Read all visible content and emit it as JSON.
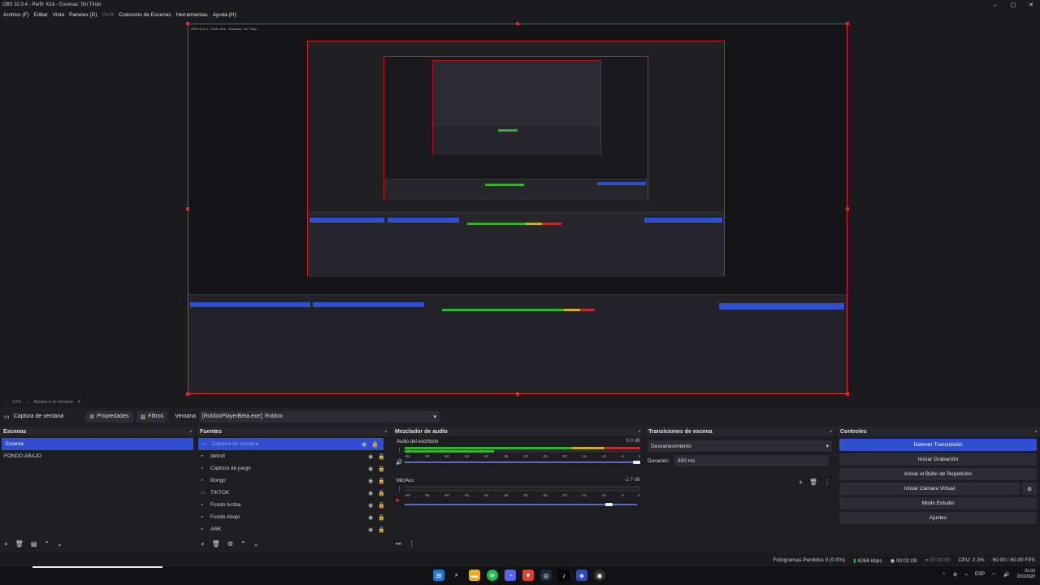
{
  "app": {
    "title": "OBS 32.0.4 - Perfil: Kick - Escenas: Sin Título",
    "window_controls": [
      "–",
      "▢",
      "✕"
    ]
  },
  "menu": {
    "items": [
      "Archivo (F)",
      "Editar",
      "Vista",
      "Paneles (D)",
      "Perfil",
      "Colección de Escenas",
      "Herramientas",
      "Ayuda (H)"
    ]
  },
  "zoom": {
    "level": "53%",
    "fit_label": "Ajustar a la ventana"
  },
  "source_bar": {
    "source_name": "Captura de ventana",
    "properties_label": "Propiedades",
    "filters_label": "Filtros",
    "window_label": "Ventana",
    "window_value": "[RobloxPlayerBeta.exe]: Roblox"
  },
  "scenes": {
    "title": "Escenas",
    "items": [
      "Escena",
      "FONDO ABAJO"
    ]
  },
  "sources": {
    "title": "Fuentes",
    "items": [
      "Captura de ventana",
      "detroit",
      "Captura de juego",
      "Bongo",
      "TIKTOK",
      "Fondo Arriba",
      "Fondo Abajo",
      "ARK"
    ]
  },
  "mixer": {
    "title": "Mezclador de audio",
    "channels": [
      {
        "name": "Audio del escritorio",
        "db": "0.0 dB",
        "level": 0.85,
        "volume": 1.0
      },
      {
        "name": "Mic/Aux",
        "db": "-2.7 dB",
        "level": 0.0,
        "volume": 0.86
      }
    ],
    "ticks": [
      "-60",
      "-55",
      "-50",
      "-45",
      "-40",
      "-35",
      "-30",
      "-25",
      "-20",
      "-15",
      "-10",
      "-5",
      "0"
    ]
  },
  "transitions": {
    "title": "Transiciones de escena",
    "selected": "Desvanecimiento",
    "duration_label": "Duración",
    "duration_value": "300 ms"
  },
  "controls": {
    "title": "Controles",
    "buttons": [
      "Detener Transmisión",
      "Iniciar Grabación",
      "Iniciar el Búfer de Repetición",
      "Iniciar Cámara Virtual",
      "Modo Estudio",
      "Ajustes"
    ]
  },
  "status": {
    "dropped_frames": "Fotogramas Perdidos 0 (0.0%)",
    "bitrate": "6266 kbps",
    "stream_time": "00:01:09",
    "rec_time": "00:00:00",
    "cpu": "CPU: 2.3%",
    "fps": "60.00 / 60.00 FPS"
  },
  "taskbar": {
    "language": "ESP",
    "time": "01:03",
    "date": "2/03/2026"
  },
  "colors": {
    "accent": "#2f4fd0",
    "preview_border": "#e02a2a",
    "meter_green": "#38b038",
    "meter_yellow": "#c8b030",
    "meter_red": "#b83030"
  }
}
